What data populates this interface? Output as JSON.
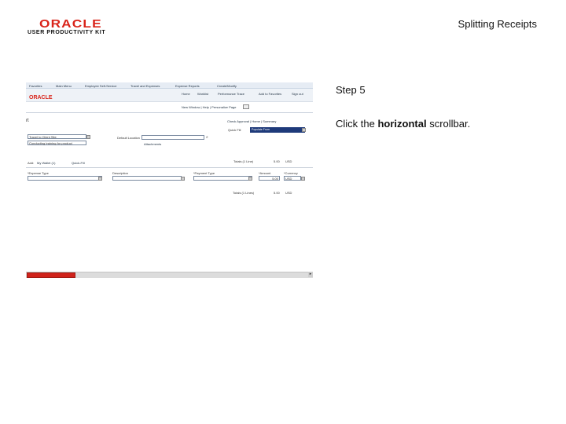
{
  "header": {
    "logo_brand": "ORACLE",
    "logo_product": "USER PRODUCTIVITY KIT",
    "slide_title": "Splitting Receipts"
  },
  "step": {
    "title": "Step 5",
    "instruction_prefix": "Click the ",
    "instruction_bold": "horizontal",
    "instruction_suffix": " scrollbar."
  },
  "screenshot": {
    "breadcrumbs": [
      "Favorites",
      "Main Menu",
      "Employee Self-Service",
      "Travel and Expenses",
      "Expense Reports",
      "Create/Modify"
    ],
    "brand": "ORACLE",
    "header_links": [
      "Home",
      "Worklist",
      "Performance Trace",
      "Add to Favorites",
      "Sign out"
    ],
    "new_window_link": "New Window | Help | Personalize Page",
    "page_label": "rt",
    "top_links": "Check Approval  |  Home  |  Summary",
    "quick_fill_label": "Quick Fill",
    "quick_fill_value": "Populate From",
    "business_purpose": "Travel to Client Site",
    "business_purpose_value": "Conducting training for product",
    "default_location_label": "Default Location",
    "attachments_label": "Attachments",
    "add_label": "Add:",
    "add_links": [
      "My Wallet (1)",
      "Quick-Fill"
    ],
    "totals_label": "Totals (1 Line)",
    "totals_amount": "5.00",
    "totals_currency": "USD",
    "columns": [
      "*Expense Type",
      "Description",
      "*Payment Type",
      "*Amount",
      "*Currency"
    ],
    "row_amount": "5.00",
    "row_currency": "USD",
    "grand_total_label": "Totals (1 Lines)",
    "grand_total_amount": "5.00",
    "grand_total_currency": "USD"
  },
  "scrollbar": {
    "arrow_right": "▸"
  }
}
